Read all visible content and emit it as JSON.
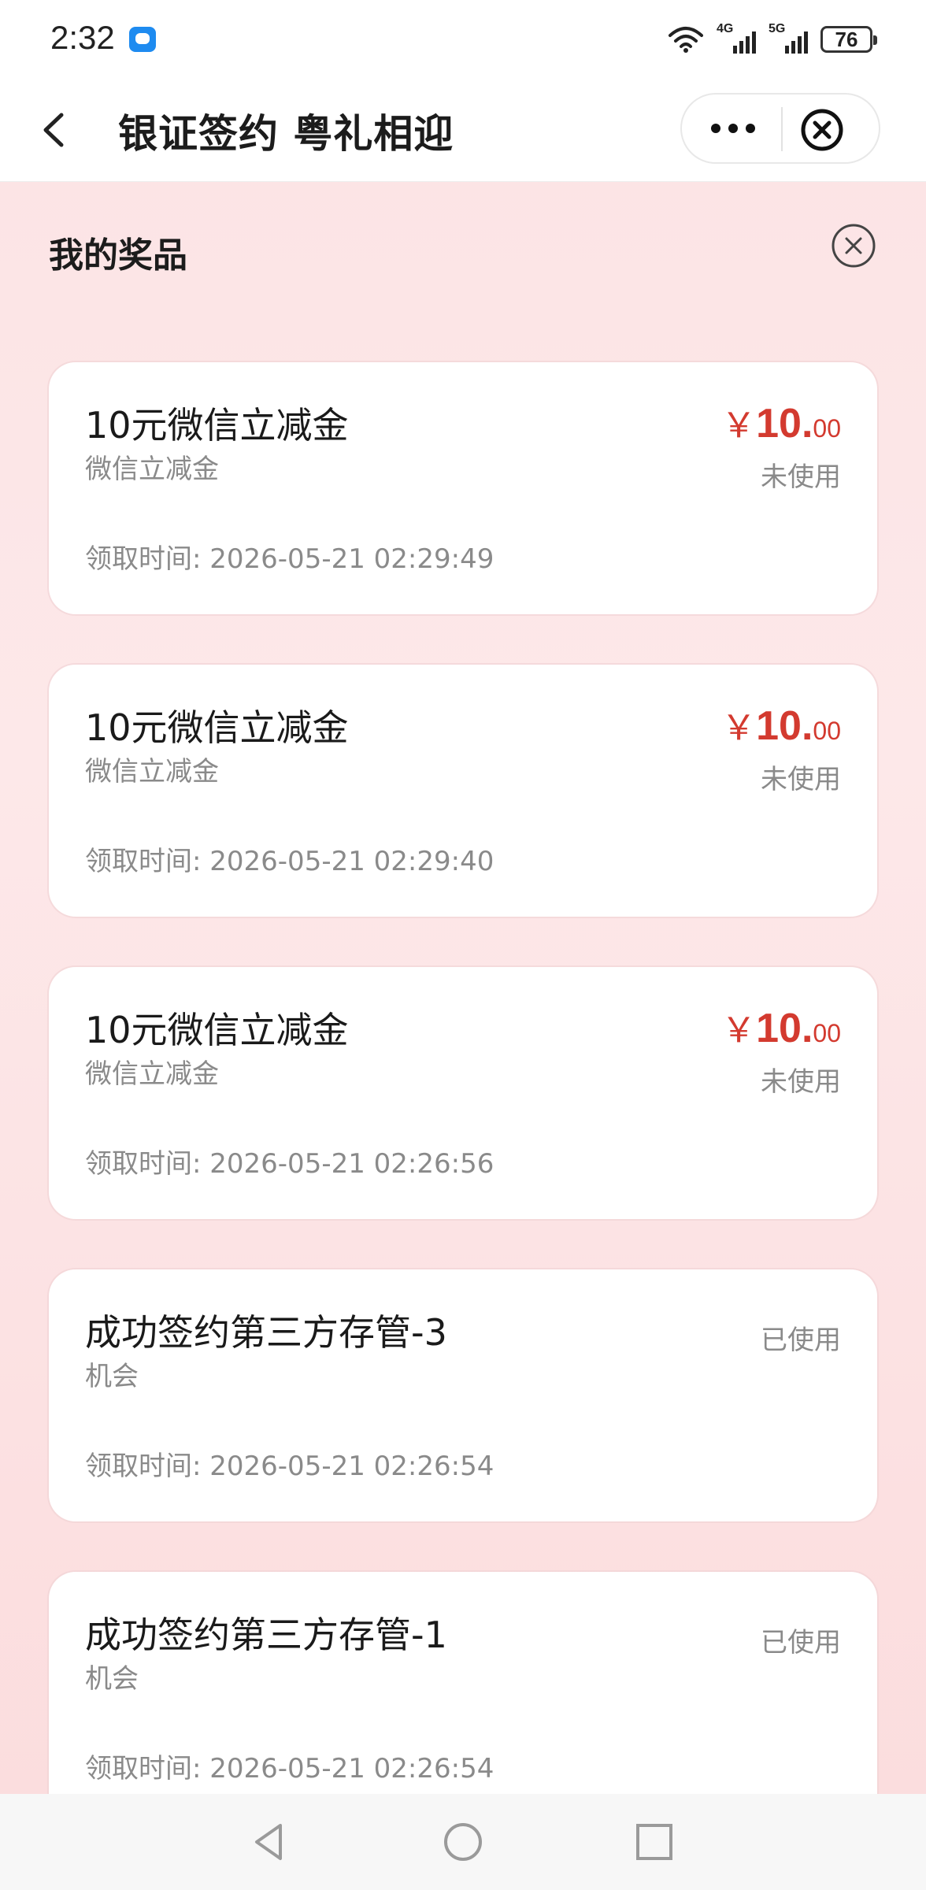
{
  "status_bar": {
    "time": "2:32",
    "network_1": "4G",
    "network_2": "5G",
    "battery": "76"
  },
  "nav": {
    "title": "银证签约 粤礼相迎"
  },
  "panel": {
    "title": "我的奖品"
  },
  "prizes": [
    {
      "title": "10元微信立减金",
      "subtitle": "微信立减金",
      "time": "领取时间: 2026-05-21 02:29:49",
      "currency": "￥",
      "amount_int": "10.",
      "amount_dec": "00",
      "status": "未使用"
    },
    {
      "title": "10元微信立减金",
      "subtitle": "微信立减金",
      "time": "领取时间: 2026-05-21 02:29:40",
      "currency": "￥",
      "amount_int": "10.",
      "amount_dec": "00",
      "status": "未使用"
    },
    {
      "title": "10元微信立减金",
      "subtitle": "微信立减金",
      "time": "领取时间: 2026-05-21 02:26:56",
      "currency": "￥",
      "amount_int": "10.",
      "amount_dec": "00",
      "status": "未使用"
    },
    {
      "title": "成功签约第三方存管-3",
      "subtitle": "机会",
      "time": "领取时间: 2026-05-21 02:26:54",
      "status": "已使用"
    },
    {
      "title": "成功签约第三方存管-1",
      "subtitle": "机会",
      "time": "领取时间: 2026-05-21 02:26:54",
      "status": "已使用"
    }
  ],
  "colors": {
    "accent_red": "#d33a2f",
    "background_pink": "#fbe3e4"
  }
}
